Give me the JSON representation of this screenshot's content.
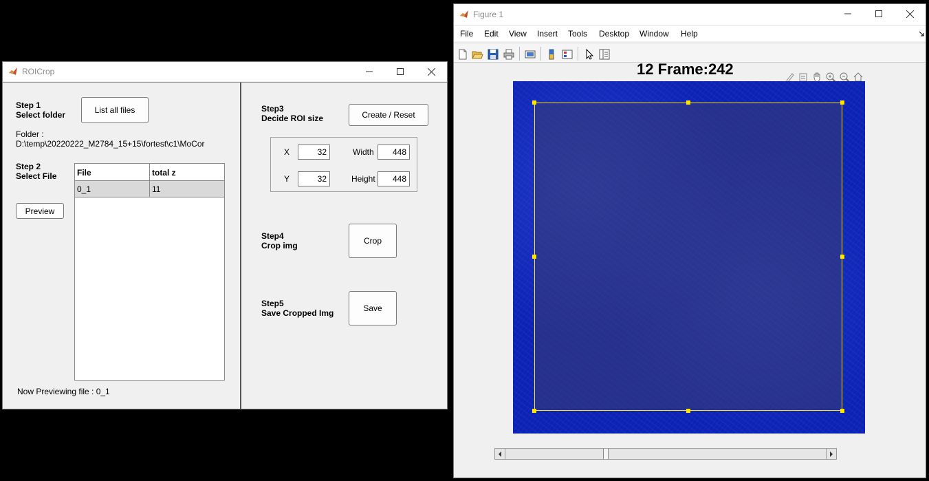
{
  "roicrop": {
    "title": "ROICrop",
    "step1": {
      "label": "Step 1",
      "sub": "Select folder",
      "button": "List all files"
    },
    "folder_label": "Folder :",
    "folder_path": "D:\\temp\\20220222_M2784_15+15\\fortest\\c1\\MoCor",
    "step2": {
      "label": "Step 2",
      "sub": "Select File"
    },
    "preview_button": "Preview",
    "table": {
      "columns": [
        "File",
        "total z"
      ],
      "rows": [
        [
          "0_1",
          "11"
        ]
      ]
    },
    "status": "Now Previewing file : 0_1",
    "step3": {
      "label": "Step3",
      "sub": "Decide ROI size",
      "button": "Create / Reset"
    },
    "roi": {
      "x_label": "X",
      "x": "32",
      "y_label": "Y",
      "y": "32",
      "width_label": "Width",
      "width": "448",
      "height_label": "Height",
      "height": "448"
    },
    "step4": {
      "label": "Step4",
      "sub": "Crop img",
      "button": "Crop"
    },
    "step5": {
      "label": "Step5",
      "sub": "Save Cropped Img",
      "button": "Save"
    }
  },
  "figure": {
    "title": "Figure 1",
    "menu": [
      "File",
      "Edit",
      "View",
      "Insert",
      "Tools",
      "Desktop",
      "Window",
      "Help"
    ],
    "plot_title": "12 Frame:242",
    "slider_position": 0.31,
    "colors": {
      "image_border": "#0a1fb0",
      "image_fill": "#1e2d9a",
      "roi_line": "#ffe600"
    }
  }
}
